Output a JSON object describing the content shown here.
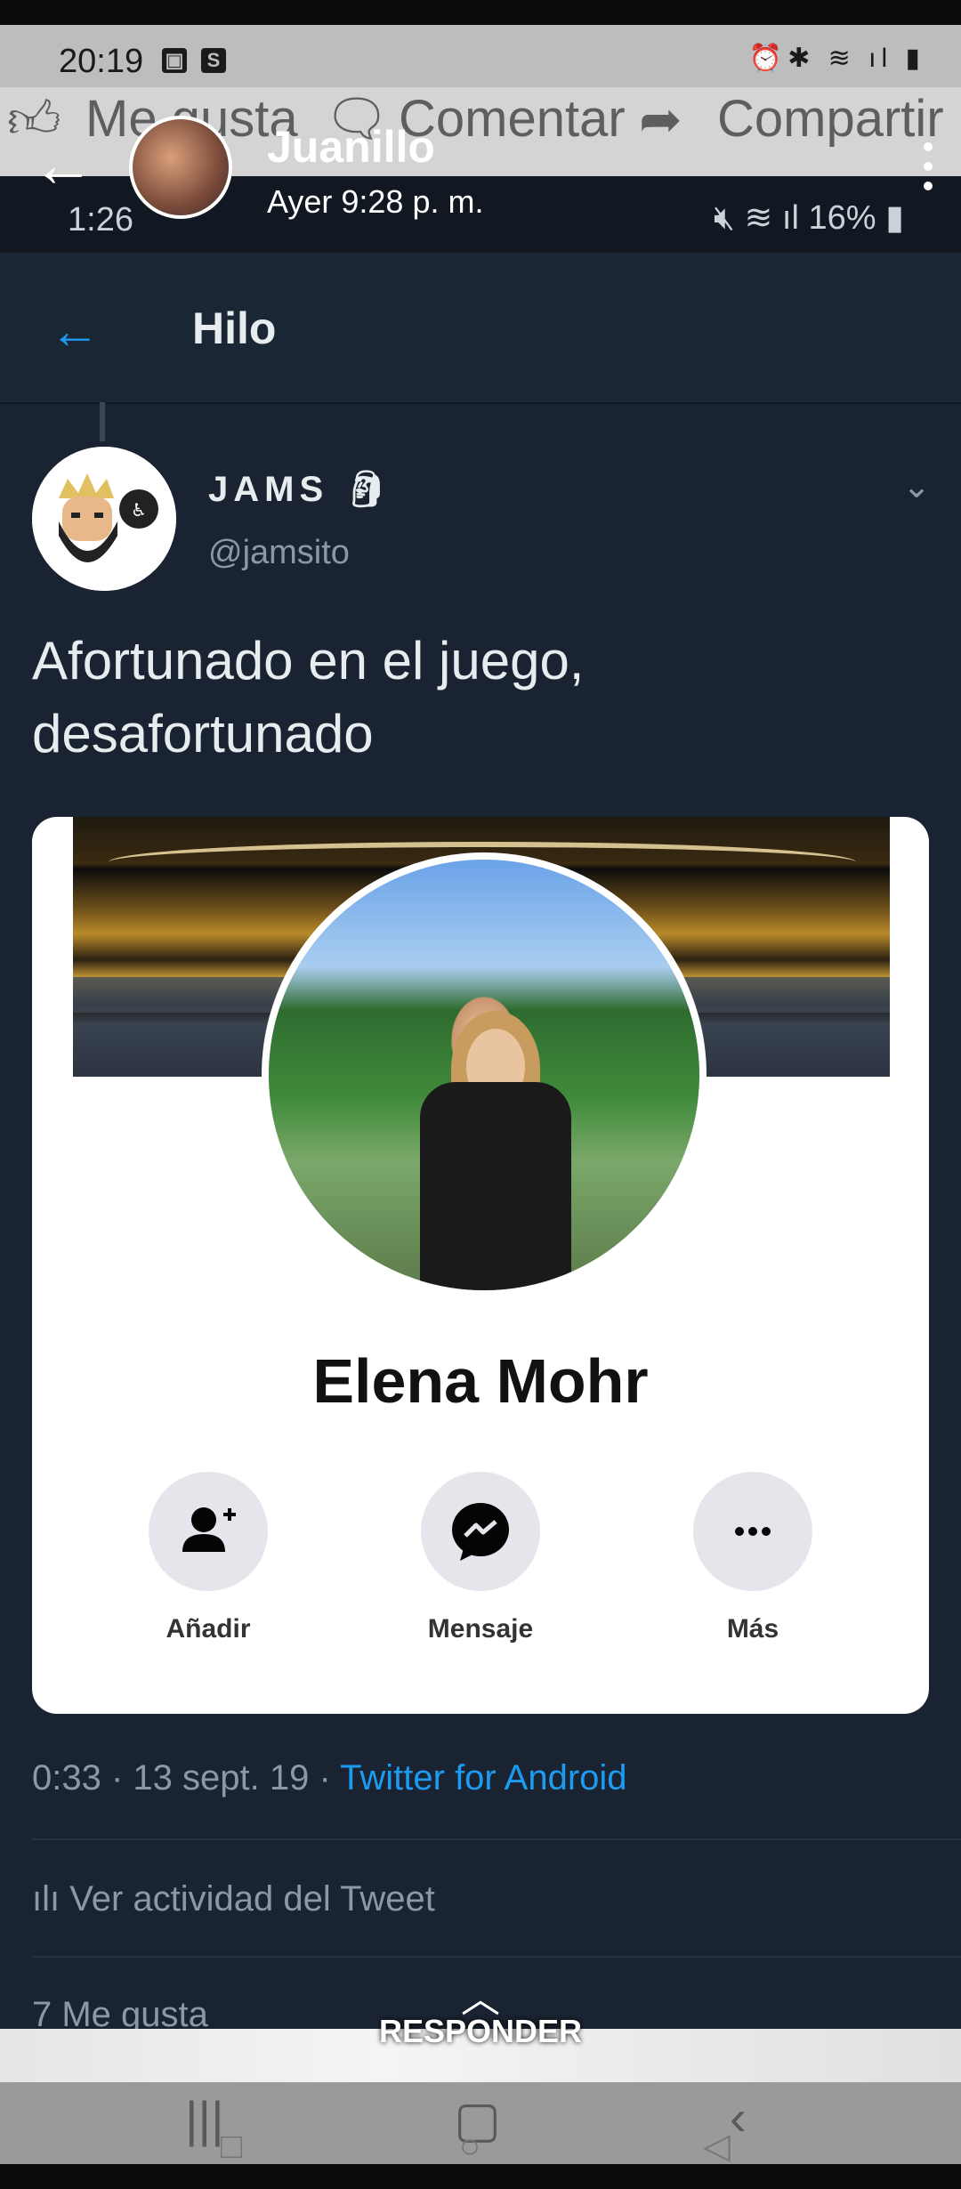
{
  "outer_status": {
    "time": "20:19",
    "icons": [
      "image-icon",
      "s-icon",
      "alarm-icon",
      "bluetooth-icon",
      "wifi-icon",
      "signal-icon",
      "battery-icon"
    ]
  },
  "fb_actions": {
    "like": "Me gusta",
    "comment": "Comentar",
    "share": "Compartir"
  },
  "viewer": {
    "name": "Juanillo",
    "time": "Ayer 9:28 p. m."
  },
  "tw_status": {
    "time": "1:26",
    "battery": "16%"
  },
  "thread": {
    "title": "Hilo"
  },
  "tweet": {
    "name": "JAMS",
    "handle": "@jamsito",
    "text": "Afortunado en el juego, desafortunado",
    "date": "0:33 · 13 sept. 19 · ",
    "source": "Twitter for Android",
    "activity": "Ver actividad del Tweet",
    "likes": "7 Me gusta"
  },
  "card": {
    "name": "Elena Mohr",
    "buttons": [
      {
        "label": "Añadir",
        "icon": "add-friend-icon"
      },
      {
        "label": "Mensaje",
        "icon": "messenger-icon"
      },
      {
        "label": "Más",
        "icon": "more-icon"
      }
    ]
  },
  "viewer_bottom": {
    "reply": "RESPONDER"
  }
}
